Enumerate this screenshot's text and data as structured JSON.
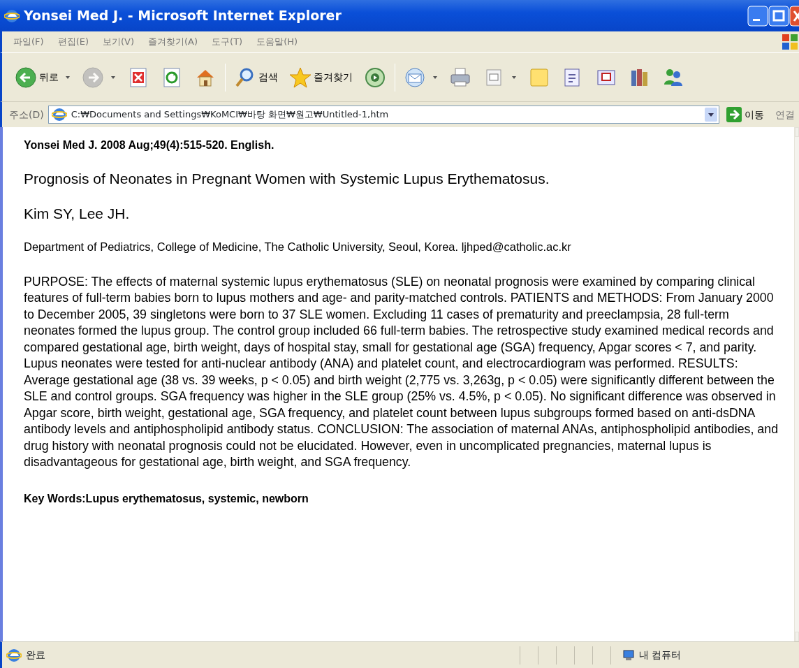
{
  "window": {
    "title": "Yonsei Med J. - Microsoft Internet Explorer"
  },
  "menu": [
    "파일(F)",
    "편집(E)",
    "보기(V)",
    "즐겨찾기(A)",
    "도구(T)",
    "도움말(H)"
  ],
  "toolbar": [
    {
      "kind": "back",
      "label": "뒤로",
      "dropdown": true,
      "disabled": false
    },
    {
      "kind": "forward",
      "dropdown": true,
      "disabled": true
    },
    {
      "kind": "stop",
      "dropdown": false,
      "disabled": false
    },
    {
      "kind": "refresh",
      "dropdown": false,
      "disabled": false
    },
    {
      "kind": "home",
      "dropdown": false,
      "disabled": false
    },
    {
      "kind": "sep"
    },
    {
      "kind": "search",
      "label": "검색",
      "dropdown": false,
      "disabled": false
    },
    {
      "kind": "favorites",
      "label": "즐겨찾기",
      "dropdown": false,
      "disabled": false
    },
    {
      "kind": "media",
      "dropdown": false,
      "disabled": false
    },
    {
      "kind": "sep"
    },
    {
      "kind": "mail",
      "dropdown": true,
      "disabled": false
    },
    {
      "kind": "print",
      "dropdown": false,
      "disabled": false
    },
    {
      "kind": "edit",
      "dropdown": true,
      "disabled": false
    },
    {
      "kind": "note",
      "dropdown": false,
      "disabled": false
    },
    {
      "kind": "discuss",
      "dropdown": false,
      "disabled": false
    },
    {
      "kind": "research",
      "dropdown": false,
      "disabled": false
    },
    {
      "kind": "books",
      "dropdown": false,
      "disabled": false
    },
    {
      "kind": "messenger",
      "dropdown": false,
      "disabled": false
    }
  ],
  "address": {
    "label": "주소(D)",
    "value": "C:₩Documents and Settings₩KoMCI₩바탕 화면₩원고₩Untitled-1,htm",
    "go": "이동",
    "links": "연결"
  },
  "document": {
    "citation": "Yonsei Med J. 2008 Aug;49(4):515-520. English.",
    "title": "Prognosis of Neonates in Pregnant Women with Systemic Lupus Erythematosus.",
    "authors": "Kim SY, Lee JH.",
    "affiliation": "Department of Pediatrics, College of Medicine, The Catholic University, Seoul, Korea. ljhped@catholic.ac.kr",
    "abstract": "PURPOSE: The effects of maternal systemic lupus erythematosus (SLE) on neonatal prognosis were examined by comparing clinical features of full-term babies born to lupus mothers and age- and parity-matched controls. PATIENTS and METHODS: From January 2000 to December 2005, 39 singletons were born to 37 SLE women. Excluding 11 cases of prematurity and preeclampsia, 28 full-term neonates formed the lupus group. The control group included 66 full-term babies. The retrospective study examined medical records and compared gestational age, birth weight, days of hospital stay, small for gestational age (SGA) frequency, Apgar scores < 7, and parity. Lupus neonates were tested for anti-nuclear antibody (ANA) and platelet count, and electrocardiogram was performed. RESULTS: Average gestational age (38 vs. 39 weeks, p < 0.05) and birth weight (2,775 vs. 3,263g, p < 0.05) were significantly different between the SLE and control groups. SGA frequency was higher in the SLE group (25% vs. 4.5%, p < 0.05). No significant difference was observed in Apgar score, birth weight, gestational age, SGA frequency, and platelet count between lupus subgroups formed based on anti-dsDNA antibody levels and antiphospholipid antibody status. CONCLUSION: The association of maternal ANAs, antiphospholipid antibodies, and drug history with neonatal prognosis could not be elucidated. However, even in uncomplicated pregnancies, maternal lupus is disadvantageous for gestational age, birth weight, and SGA frequency.",
    "keywords": "Key Words:Lupus erythematosus, systemic, newborn"
  },
  "status_bar": {
    "text": "완료",
    "zone": "내 컴퓨터"
  }
}
